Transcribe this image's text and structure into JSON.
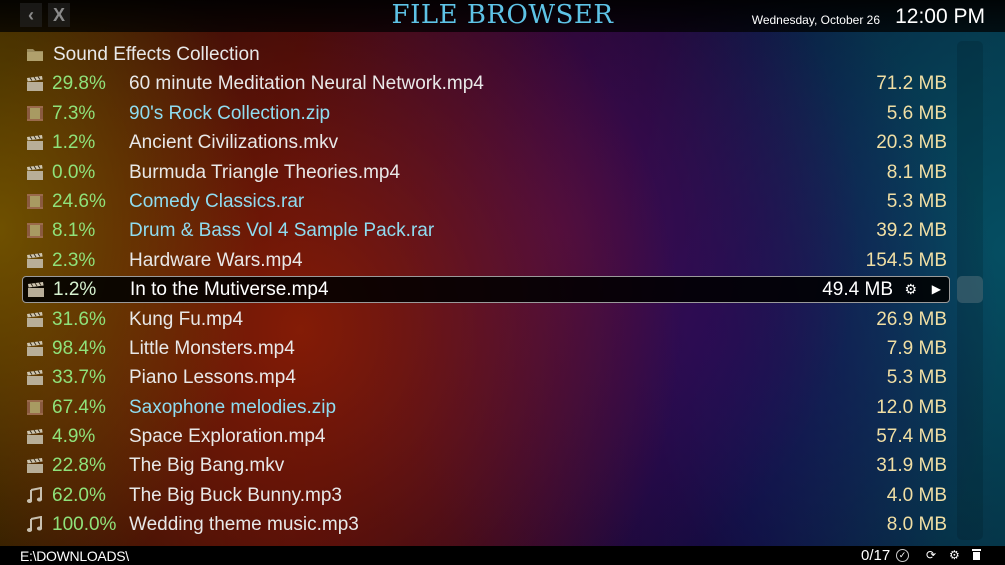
{
  "header": {
    "back_icon": "chevron-left-icon",
    "close_icon": "close-icon",
    "back_glyph": "‹",
    "close_glyph": "X",
    "title": "FILE BROWSER",
    "date": "Wednesday, October 26",
    "time": "12:00 PM"
  },
  "colors": {
    "title": "#5ec3e6",
    "percent": "#8fe27a",
    "size": "#f1dfa4",
    "archive_name": "#8fdcf0",
    "file_name": "#e8e8e8"
  },
  "folder": {
    "icon": "folder-icon",
    "name": "Sound Effects Collection"
  },
  "files": [
    {
      "icon": "video-clapper-icon",
      "type": "video",
      "progress": "29.8%",
      "name": "60 minute Meditation Neural Network.mp4",
      "size": "71.2 MB"
    },
    {
      "icon": "archive-icon",
      "type": "archive",
      "progress": "7.3%",
      "name": "90's Rock Collection.zip",
      "size": "5.6 MB"
    },
    {
      "icon": "video-clapper-icon",
      "type": "video",
      "progress": "1.2%",
      "name": "Ancient Civilizations.mkv",
      "size": "20.3 MB"
    },
    {
      "icon": "video-clapper-icon",
      "type": "video",
      "progress": "0.0%",
      "name": "Burmuda Triangle Theories.mp4",
      "size": "8.1 MB"
    },
    {
      "icon": "archive-icon",
      "type": "archive",
      "progress": "24.6%",
      "name": "Comedy Classics.rar",
      "size": "5.3 MB"
    },
    {
      "icon": "archive-icon",
      "type": "archive",
      "progress": "8.1%",
      "name": "Drum & Bass Vol 4 Sample Pack.rar",
      "size": "39.2 MB"
    },
    {
      "icon": "video-clapper-icon",
      "type": "video",
      "progress": "2.3%",
      "name": "Hardware Wars.mp4",
      "size": "154.5 MB"
    },
    {
      "icon": "video-clapper-icon",
      "type": "video",
      "progress": "1.2%",
      "name": "In to the Mutiverse.mp4",
      "size": "49.4 MB",
      "selected": true
    },
    {
      "icon": "video-clapper-icon",
      "type": "video",
      "progress": "31.6%",
      "name": "Kung Fu.mp4",
      "size": "26.9 MB"
    },
    {
      "icon": "video-clapper-icon",
      "type": "video",
      "progress": "98.4%",
      "name": "Little Monsters.mp4",
      "size": "7.9 MB"
    },
    {
      "icon": "video-clapper-icon",
      "type": "video",
      "progress": "33.7%",
      "name": "Piano Lessons.mp4",
      "size": "5.3 MB"
    },
    {
      "icon": "archive-icon",
      "type": "archive",
      "progress": "67.4%",
      "name": "Saxophone melodies.zip",
      "size": "12.0 MB"
    },
    {
      "icon": "video-clapper-icon",
      "type": "video",
      "progress": "4.9%",
      "name": "Space Exploration.mp4",
      "size": "57.4 MB"
    },
    {
      "icon": "video-clapper-icon",
      "type": "video",
      "progress": "22.8%",
      "name": "The Big Bang.mkv",
      "size": "31.9 MB"
    },
    {
      "icon": "music-note-icon",
      "type": "audio",
      "progress": "62.0%",
      "name": "The Big Buck Bunny.mp3",
      "size": "4.0 MB"
    },
    {
      "icon": "music-note-icon",
      "type": "audio",
      "progress": "100.0%",
      "name": "Wedding theme music.mp3",
      "size": "8.0 MB"
    }
  ],
  "selected_actions": {
    "settings_icon": "gear-icon",
    "play_icon": "play-icon"
  },
  "statusbar": {
    "path": "E:\\DOWNLOADS\\",
    "count": "0/17",
    "icons": [
      "check-circle-icon",
      "refresh-icon",
      "gear-icon",
      "trash-icon"
    ]
  }
}
